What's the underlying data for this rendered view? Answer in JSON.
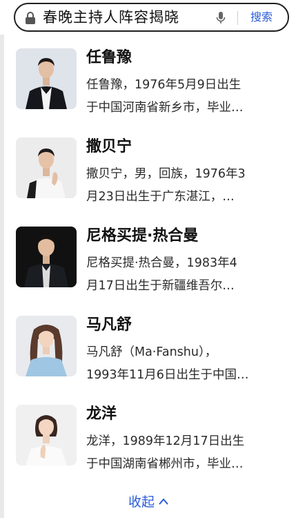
{
  "search": {
    "query": "春晚主持人阵容揭晓",
    "button_label": "搜索"
  },
  "results": [
    {
      "name": "任鲁豫",
      "snippet_line1": "任鲁豫，1976年5月9日出生",
      "snippet_line2": "于中国河南省新乡市，毕业…"
    },
    {
      "name": "撒贝宁",
      "snippet_line1": "撒贝宁，男，回族，1976年3",
      "snippet_line2": "月23日出生于广东湛江，…"
    },
    {
      "name": "尼格买提·热合曼",
      "snippet_line1": "尼格买提·热合曼，1983年4",
      "snippet_line2": "月17日出生于新疆维吾尔…"
    },
    {
      "name": "马凡舒",
      "snippet_line1": "马凡舒（Ma·Fanshu），",
      "snippet_line2": "1993年11月6日出生于中国…"
    },
    {
      "name": "龙洋",
      "snippet_line1": "龙洋，1989年12月17日出生",
      "snippet_line2": "于中国湖南省郴州市，毕业…"
    }
  ],
  "collapse_label": "收起",
  "colors": {
    "link_blue": "#2a5bd7",
    "text_dark": "#111111",
    "snippet_text": "#2a2a2a"
  }
}
